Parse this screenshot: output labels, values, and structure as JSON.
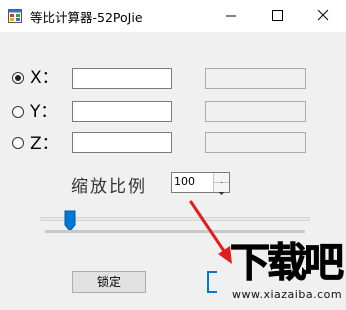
{
  "window": {
    "title": "等比计算器-52PoJie",
    "icon": "calculator-app-icon"
  },
  "controls": {
    "minimize_icon": "minimize-icon",
    "maximize_icon": "maximize-icon",
    "close_icon": "close-icon"
  },
  "rows": [
    {
      "label": "X：",
      "selected": true,
      "value": "",
      "result": ""
    },
    {
      "label": "Y：",
      "selected": false,
      "value": "",
      "result": ""
    },
    {
      "label": "Z：",
      "selected": false,
      "value": "",
      "result": ""
    }
  ],
  "scale": {
    "label": "缩放比例",
    "value": "100",
    "slider_fraction": 0.1
  },
  "buttons": {
    "lock_label": "锁定"
  },
  "watermark": {
    "brand": "下载吧",
    "url": "www.xiazaiba.com"
  },
  "colors": {
    "accent": "#0078d7",
    "arrow": "#e02020",
    "window_bg": "#f0f0f0"
  }
}
